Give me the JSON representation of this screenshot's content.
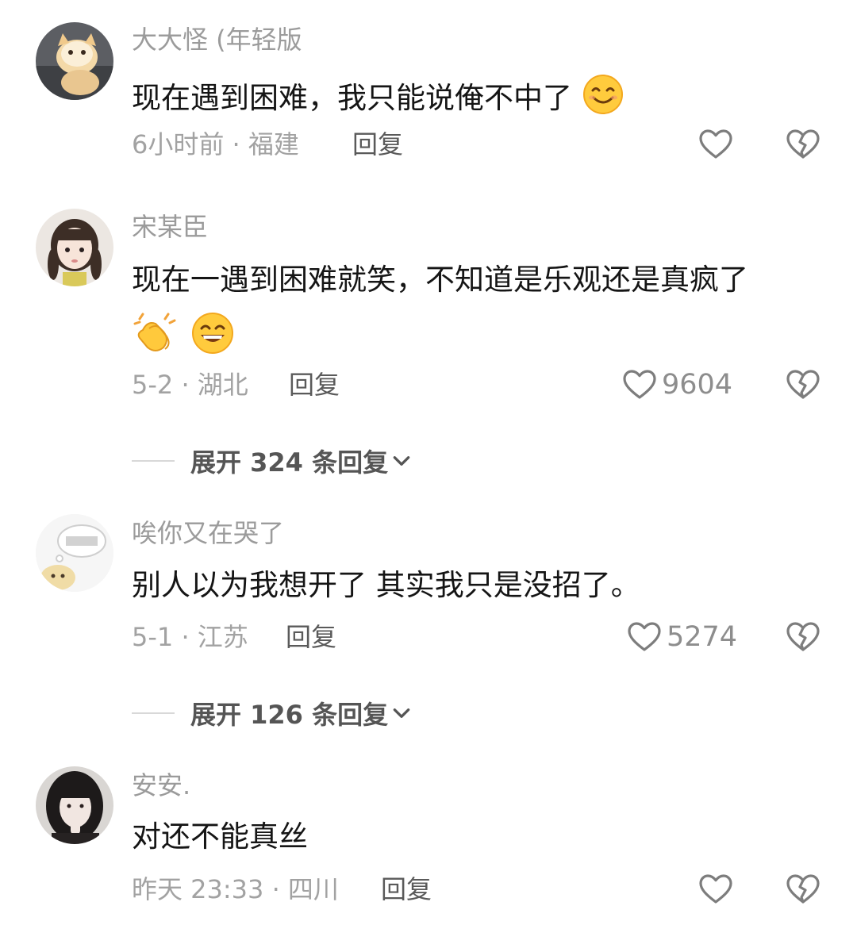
{
  "comments": [
    {
      "username": "大大怪 (年轻版",
      "text": "现在遇到困难，我只能说俺不中了",
      "emoji_icons": [
        "smiling-face-emoji"
      ],
      "meta": "6小时前 · 福建",
      "reply_label": "回复",
      "like_count": ""
    },
    {
      "username": "宋某臣",
      "text": "现在一遇到困难就笑，不知道是乐观还是真疯了",
      "emoji_icons": [
        "clapping-hands-emoji",
        "grinning-face-emoji"
      ],
      "meta": "5-2 · 湖北",
      "reply_label": "回复",
      "like_count": "9604",
      "expand_label": "展开 324 条回复"
    },
    {
      "username": "唉你又在哭了",
      "text": "别人以为我想开了 其实我只是没招了。",
      "meta": "5-1 · 江苏",
      "reply_label": "回复",
      "like_count": "5274",
      "expand_label": "展开 126 条回复"
    },
    {
      "username": "安安.",
      "text": "对还不能真丝",
      "meta": "昨天 23:33 · 四川",
      "reply_label": "回复",
      "like_count": ""
    }
  ],
  "icons": {
    "like": "heart-outline-icon",
    "dislike": "broken-heart-icon",
    "expand": "chevron-down-icon"
  },
  "colors": {
    "username": "#9b9b9b",
    "text": "#151515",
    "meta": "#a2a2a2",
    "icon": "#7d7d7d"
  }
}
